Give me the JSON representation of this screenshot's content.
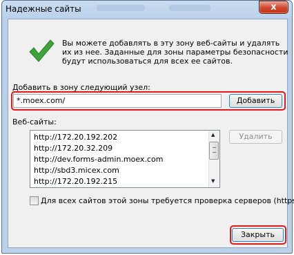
{
  "window": {
    "title": "Надежные сайты",
    "close_symbol": "x"
  },
  "info": {
    "icon": "checkmark-icon",
    "text": "Вы можете добавлять в эту зону  веб-сайты и удалять их из нее. Заданные для зоны параметры безопасности будут использоваться для всех ее сайтов."
  },
  "add": {
    "label": "Добавить в зону следующий узел:",
    "value": "*.moex.com/",
    "button": "Добавить"
  },
  "sites": {
    "label": "Веб-сайты:",
    "items": [
      "http://172.20.192.202",
      "http://172.20.32.209",
      "http://dev.forms-admin.moex.com",
      "http://sbd3.micex.com",
      "http://172.20.192.215"
    ],
    "remove_button": "Удалить"
  },
  "https_check": {
    "label": "Для всех сайтов этой зоны требуется проверка серверов (https:)",
    "checked": false
  },
  "footer": {
    "close_button": "Закрыть"
  },
  "colors": {
    "highlight": "#e01919",
    "titlebar": "#bcd2ea",
    "close_red": "#c13417"
  }
}
